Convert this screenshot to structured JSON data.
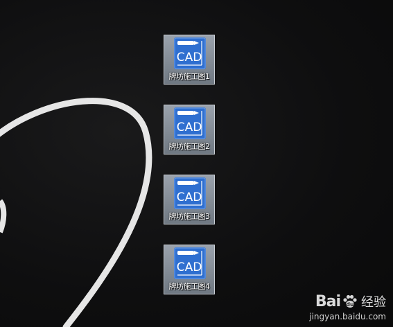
{
  "desktop": {
    "icons": [
      {
        "text": "CAD",
        "label": "牌坊施工图1"
      },
      {
        "text": "CAD",
        "label": "牌坊施工图2"
      },
      {
        "text": "CAD",
        "label": "牌坊施工图3"
      },
      {
        "text": "CAD",
        "label": "牌坊施工图4"
      }
    ]
  },
  "watermark": {
    "brand_left": "Bai",
    "brand_right": "经验",
    "url": "jingyan.baidu.com"
  },
  "colors": {
    "icon_blue": "#2f6fd0",
    "background": "#0f0f10"
  }
}
